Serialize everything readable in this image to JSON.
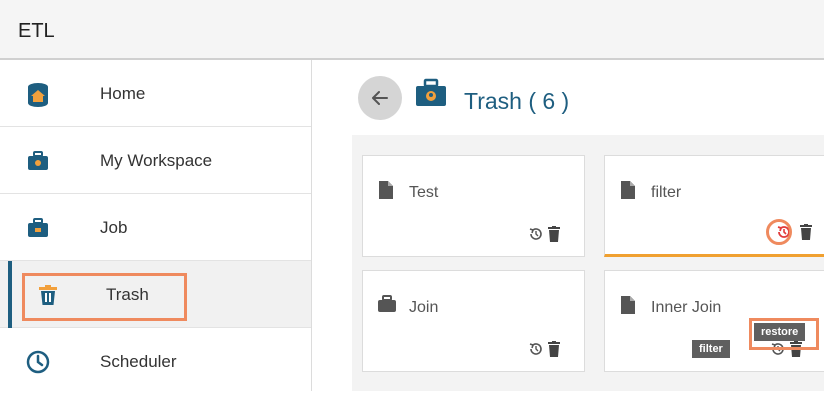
{
  "app": {
    "title": "ETL"
  },
  "sidebar": {
    "items": [
      {
        "label": "Home",
        "icon": "home-icon"
      },
      {
        "label": "My Workspace",
        "icon": "workspace-briefcase-icon"
      },
      {
        "label": "Job",
        "icon": "job-briefcase-icon"
      },
      {
        "label": "Trash",
        "icon": "trash-icon",
        "active": true
      },
      {
        "label": "Scheduler",
        "icon": "clock-icon"
      }
    ]
  },
  "main": {
    "title": "Trash ( 6 )",
    "cards": [
      {
        "name": "Test",
        "type": "document"
      },
      {
        "name": "filter",
        "type": "document",
        "selected": true
      },
      {
        "name": "Join",
        "type": "briefcase"
      },
      {
        "name": "Inner Join",
        "type": "document"
      }
    ],
    "tooltips": {
      "card_name": "filter",
      "restore": "restore"
    }
  },
  "colors": {
    "accent_blue": "#1e5e80",
    "highlight_orange": "#ef8a5e",
    "restore_red": "#e23b3b",
    "selected_bar": "#f0a030"
  }
}
